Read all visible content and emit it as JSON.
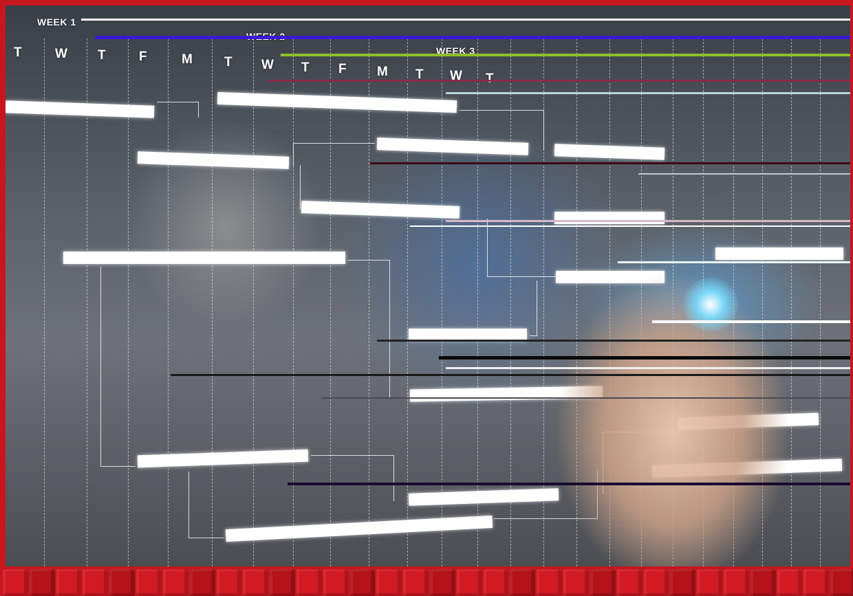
{
  "gantt": {
    "weeks": [
      "WEEK 1",
      "WEEK 2",
      "WEEK 3"
    ],
    "days": [
      "T",
      "W",
      "T",
      "F",
      "M",
      "T",
      "W",
      "T",
      "F",
      "M",
      "T",
      "W",
      "T"
    ]
  },
  "colors": {
    "frame": "#c7161e",
    "bar": "#ffffff",
    "pen_glow": "#78dcff"
  }
}
